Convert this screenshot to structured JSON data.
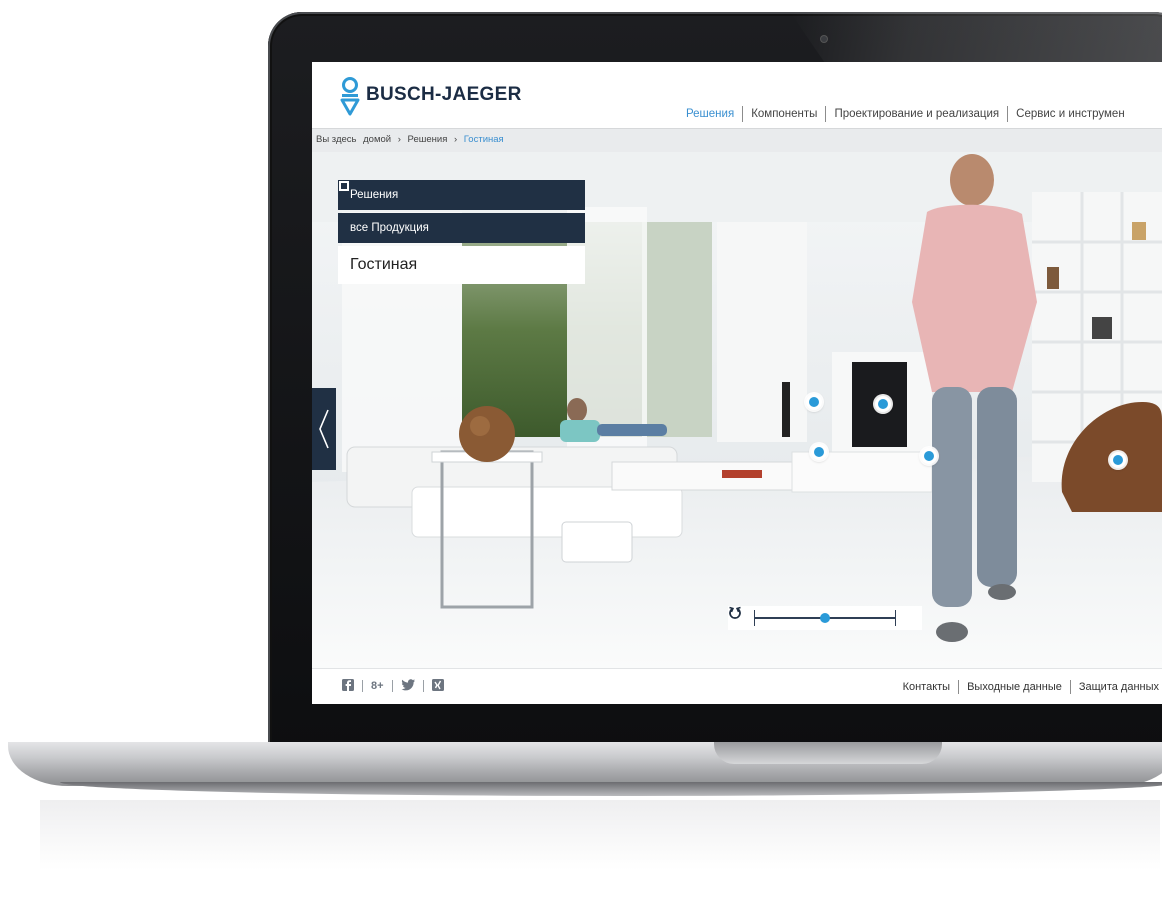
{
  "brand": {
    "name": "BUSCH-JAEGER",
    "color": "#1b2c44",
    "accent": "#3a8fd0"
  },
  "nav": {
    "items": [
      {
        "label": "Решения",
        "active": true
      },
      {
        "label": "Компоненты",
        "active": false
      },
      {
        "label": "Проектирование и реализация",
        "active": false
      },
      {
        "label": "Сервис и инструмен",
        "active": false
      }
    ]
  },
  "breadcrumb": {
    "prefix": "Вы здесь",
    "items": [
      "домой",
      "Решения",
      "Гостиная"
    ],
    "separator": "›"
  },
  "panel": {
    "solutions_label": "Решения",
    "products_label": "все Продукция",
    "room_title": "Гостиная",
    "panel_color": "#203044"
  },
  "viewer": {
    "prev_arrow_icon": "chevron-left-icon",
    "rotate_left_icon": "rotate-left-icon",
    "rotate_right_icon": "rotate-right-icon",
    "rotation_value": 0.5,
    "hotspot_color": "#2a9ad8",
    "hotspot_count": 5
  },
  "footer": {
    "social": [
      "facebook-icon",
      "google-plus-icon",
      "twitter-icon",
      "xing-icon"
    ],
    "links": [
      "Контакты",
      "Выходные данные",
      "Защита данных"
    ]
  }
}
